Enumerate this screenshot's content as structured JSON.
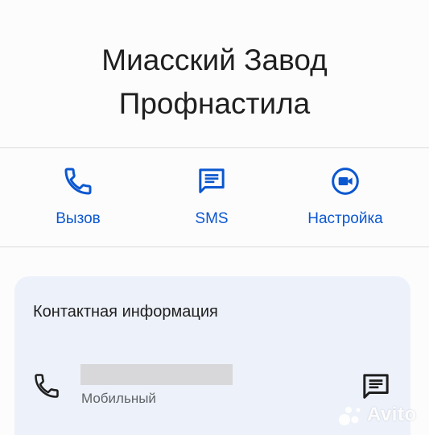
{
  "contact": {
    "name_line1": "Миасский Завод",
    "name_line2": "Профнастила"
  },
  "actions": [
    {
      "label": "Вызов",
      "icon": "phone-icon"
    },
    {
      "label": "SMS",
      "icon": "message-icon"
    },
    {
      "label": "Настройка",
      "icon": "video-call-icon"
    }
  ],
  "contact_info": {
    "title": "Контактная информация",
    "phone_type": "Мобильный",
    "phone_icon": "phone-icon",
    "message_icon": "message-icon"
  },
  "watermark": {
    "text": "Avito"
  },
  "colors": {
    "accent": "#0b57d0",
    "card_background": "#edf1fa",
    "text_primary": "#1f1f1f",
    "text_secondary": "#5f6368"
  }
}
